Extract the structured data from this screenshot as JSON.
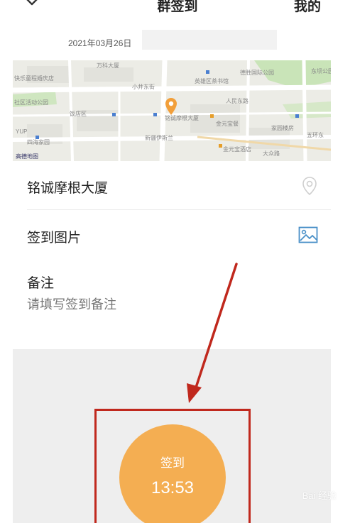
{
  "header": {
    "title": "群签到",
    "mine_label": "我的",
    "back_icon": "chevron-down-icon"
  },
  "date": "2021年03月26日",
  "map": {
    "labels": [
      "万科大厦",
      "快乐童程婚庆店",
      "小井东街",
      "英雄区茶书馆",
      "德胜国际公园",
      "东坝公园",
      "社区活动公园",
      "饭店区",
      "铭诚摩根大厦",
      "人民东路",
      "金元宝餐",
      "家园楼房",
      "新疆伊斯兰",
      "四海家园",
      "五环东",
      "金元宝酒店",
      "大众路",
      "YUP",
      "高德地图"
    ],
    "pin_color": "#f29f3a"
  },
  "location": {
    "name": "铭诚摩根大厦",
    "icon": "location-pin-icon"
  },
  "photo": {
    "label": "签到图片",
    "icon": "image-icon"
  },
  "remark": {
    "label": "备注",
    "placeholder": "请填写签到备注"
  },
  "checkin": {
    "label": "签到",
    "time": "13:53",
    "color": "#f4ae52"
  },
  "annotation": {
    "color": "#c0281d"
  },
  "watermark": "Bai 经验"
}
